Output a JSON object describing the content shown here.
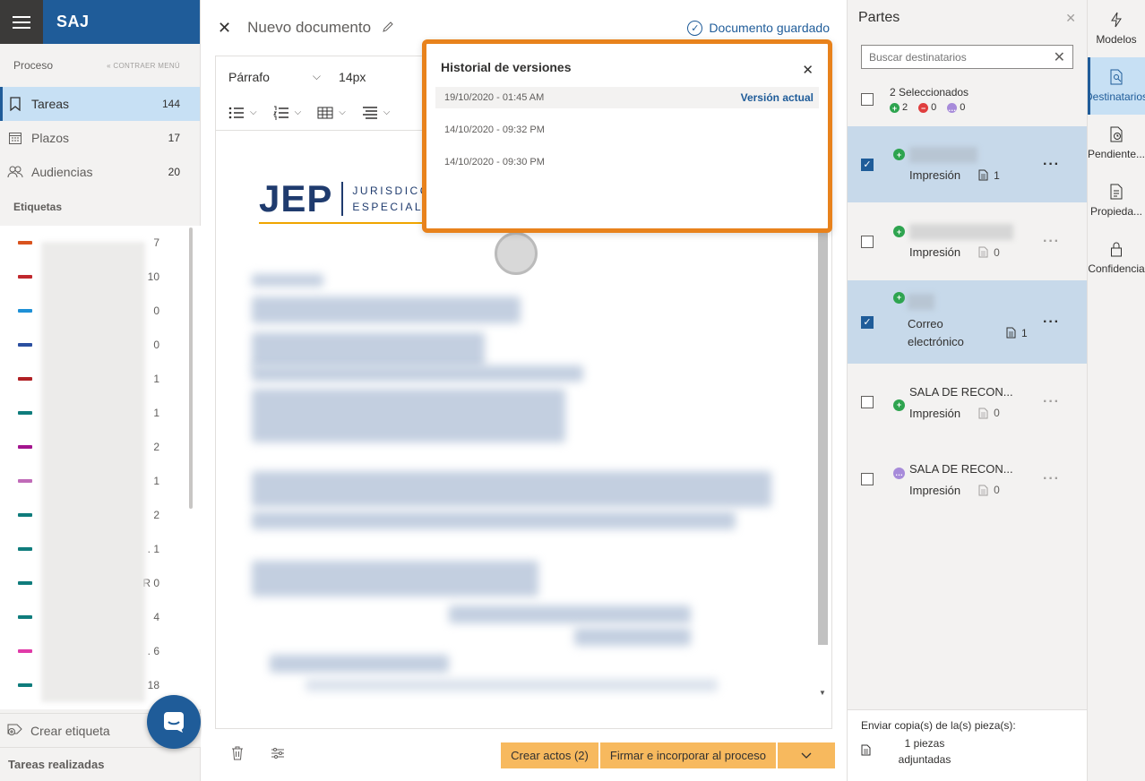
{
  "app": {
    "title": "SAJ"
  },
  "sidebar": {
    "section_label": "Proceso",
    "collapse_label": "« CONTRAER MENÚ",
    "items": [
      {
        "label": "Tareas",
        "count": "144",
        "icon": "bookmark-icon"
      },
      {
        "label": "Plazos",
        "count": "17",
        "icon": "calendar-icon"
      },
      {
        "label": "Audiencias",
        "count": "20",
        "icon": "people-icon"
      }
    ],
    "tags_label": "Etiquetas",
    "tags": [
      {
        "color": "#d9531e",
        "count": "7"
      },
      {
        "color": "#c0282d",
        "count": "10"
      },
      {
        "color": "#1e90d6",
        "count": "0"
      },
      {
        "color": "#2b4fa0",
        "count": "0"
      },
      {
        "color": "#b02024",
        "count": "1"
      },
      {
        "color": "#0f7c7c",
        "count": "1"
      },
      {
        "color": "#a3148e",
        "count": "2"
      },
      {
        "color": "#c06bb8",
        "count": "1"
      },
      {
        "color": "#0f7c7c",
        "count": "2"
      },
      {
        "color": "#0f7c7c",
        "count": ". 1"
      },
      {
        "color": "#0f7c7c",
        "count": "R 0"
      },
      {
        "color": "#0f7c7c",
        "count": "4"
      },
      {
        "color": "#e03aa8",
        "count": ". 6"
      },
      {
        "color": "#0f7c7c",
        "count": "18"
      }
    ],
    "create_tag_label": "Crear etiqueta",
    "done_label": "Tareas realizadas"
  },
  "editor": {
    "title": "Nuevo documento",
    "saved_label": "Documento guardado",
    "paragraph_style": "Párrafo",
    "font_size": "14px",
    "logo_big": "JEP",
    "logo_line1": "JURISDICC",
    "logo_line2": "ESPECIAL",
    "buttons": {
      "create_acts": "Crear actos (2)",
      "sign": "Firmar e incorporar al proceso"
    }
  },
  "version_history": {
    "title": "Historial de versiones",
    "current_label": "Versión actual",
    "versions": [
      "19/10/2020 - 01:45 AM",
      "14/10/2020 - 09:32 PM",
      "14/10/2020 - 09:30 PM"
    ]
  },
  "parties": {
    "title": "Partes",
    "search_placeholder": "Buscar destinatarios",
    "selected_label": "2 Seleccionados",
    "counts": {
      "green": "2",
      "red": "0",
      "purple": "0"
    },
    "items": [
      {
        "name": "",
        "type": "Impresión",
        "docs": "1",
        "selected": true,
        "status": "green"
      },
      {
        "name": "",
        "type": "Impresión",
        "docs": "0",
        "selected": false,
        "status": "green"
      },
      {
        "name": "",
        "type": "Correo electrónico",
        "docs": "1",
        "selected": true,
        "status": "green"
      },
      {
        "name": "SALA DE RECON...",
        "type": "Impresión",
        "docs": "0",
        "selected": false,
        "status": "green"
      },
      {
        "name": "SALA DE RECON...",
        "type": "Impresión",
        "docs": "0",
        "selected": false,
        "status": "purple"
      }
    ],
    "footer_label": "Enviar copia(s) de la(s) pieza(s):",
    "footer_pieces": "1 piezas adjuntadas"
  },
  "rail": [
    {
      "label": "Modelos",
      "icon": "lightning-icon"
    },
    {
      "label": "Destinatarios",
      "icon": "recipients-icon"
    },
    {
      "label": "Pendiente...",
      "icon": "pending-icon"
    },
    {
      "label": "Propieda...",
      "icon": "properties-icon"
    },
    {
      "label": "Confidencia",
      "icon": "lock-icon"
    }
  ]
}
